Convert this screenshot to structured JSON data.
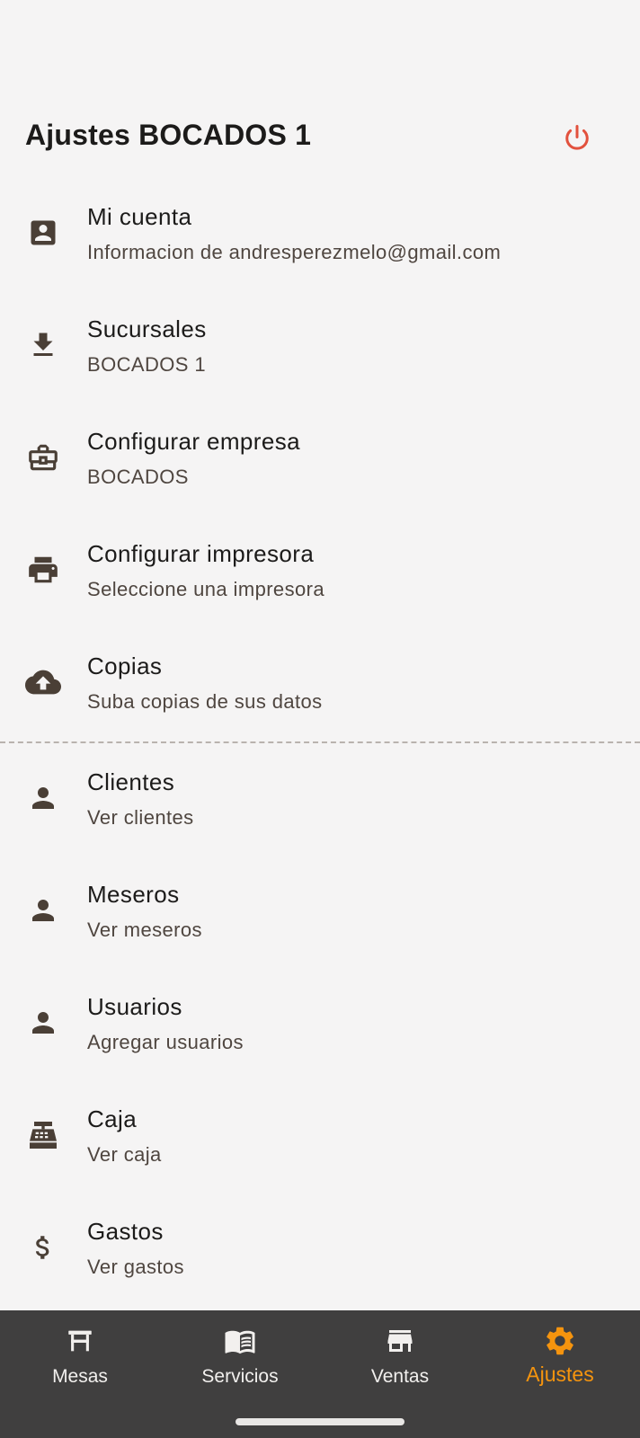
{
  "header": {
    "title": "Ajustes BOCADOS 1",
    "power_icon": "power-icon"
  },
  "colors": {
    "background": "#f5f4f4",
    "icon": "#4a3f36",
    "power": "#e2513d",
    "nav_bg": "#403f3f",
    "nav_active": "#f5940e",
    "nav_inactive": "#f2f0ee"
  },
  "settings": {
    "account": {
      "icon": "account-box-icon",
      "title": "Mi cuenta",
      "subtitle": "Informacion de andresperezmelo@gmail.com"
    },
    "branches": {
      "icon": "download-icon",
      "title": "Sucursales",
      "subtitle": "BOCADOS 1"
    },
    "company": {
      "icon": "briefcase-icon",
      "title": "Configurar empresa",
      "subtitle": "BOCADOS"
    },
    "printer": {
      "icon": "printer-icon",
      "title": "Configurar impresora",
      "subtitle": "Seleccione una impresora"
    },
    "backups": {
      "icon": "cloud-upload-icon",
      "title": "Copias",
      "subtitle": "Suba copias de sus datos"
    },
    "clients": {
      "icon": "person-icon",
      "title": "Clientes",
      "subtitle": "Ver clientes"
    },
    "waiters": {
      "icon": "person-icon",
      "title": "Meseros",
      "subtitle": "Ver meseros"
    },
    "users": {
      "icon": "person-icon",
      "title": "Usuarios",
      "subtitle": "Agregar usuarios"
    },
    "cashbox": {
      "icon": "cash-register-icon",
      "title": "Caja",
      "subtitle": "Ver caja"
    },
    "expenses": {
      "icon": "dollar-icon",
      "title": "Gastos",
      "subtitle": "Ver gastos"
    }
  },
  "bottom_nav": {
    "tables": {
      "icon": "table-icon",
      "label": "Mesas"
    },
    "services": {
      "icon": "menu-book-icon",
      "label": "Servicios"
    },
    "sales": {
      "icon": "store-icon",
      "label": "Ventas"
    },
    "settings": {
      "icon": "gear-icon",
      "label": "Ajustes",
      "active": true
    }
  }
}
